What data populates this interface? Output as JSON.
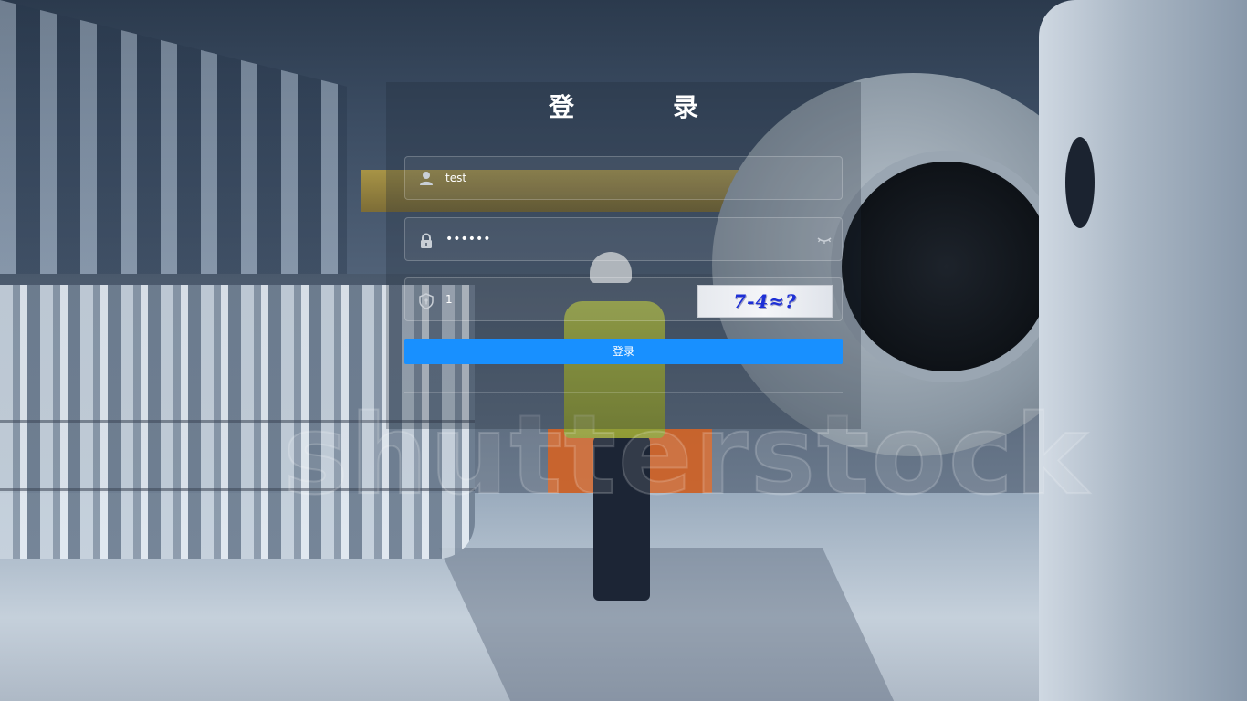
{
  "login": {
    "title": "登　录",
    "username": {
      "value": "test",
      "icon": "user-icon"
    },
    "password": {
      "value": "••••••",
      "icon": "lock-icon",
      "toggle_icon": "eye-closed-icon"
    },
    "captcha": {
      "value": "1",
      "icon": "shield-icon",
      "image_text": "7-4≈?"
    },
    "submit_label": "登录"
  },
  "colors": {
    "primary": "#1890ff",
    "text": "#ffffff",
    "captcha_text": "#1d2fd6"
  }
}
